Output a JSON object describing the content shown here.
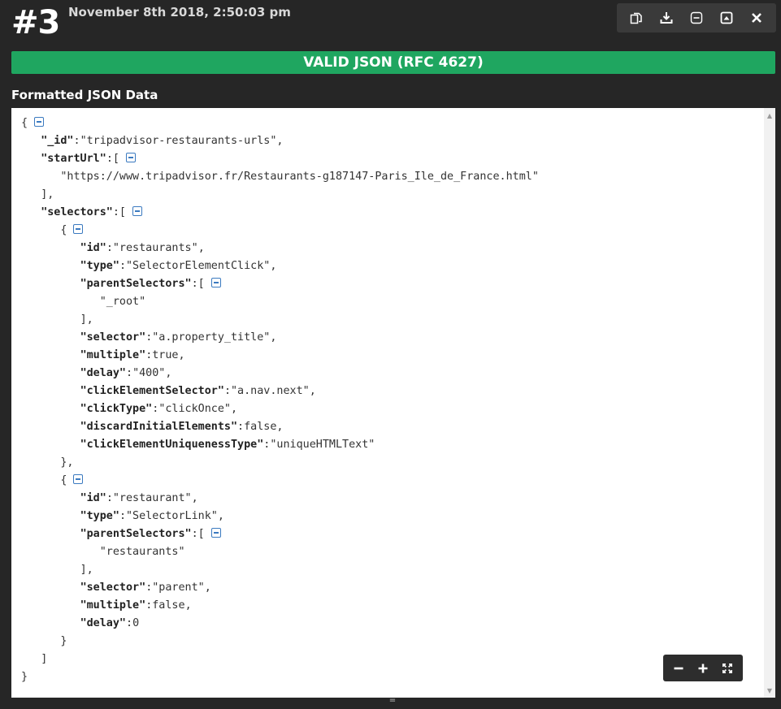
{
  "header": {
    "number": "#3",
    "timestamp": "November 8th 2018, 2:50:03 pm"
  },
  "toolbar": {
    "icons": [
      "copy-icon",
      "download-icon",
      "collapse-icon",
      "expand-up-icon",
      "close-icon"
    ]
  },
  "status": {
    "text": "VALID JSON (RFC 4627)",
    "color": "#1fa660"
  },
  "section_label": "Formatted JSON Data",
  "json": {
    "id_key": "\"_id\"",
    "id_val": "\"tripadvisor-restaurants-urls\"",
    "starturl_key": "\"startUrl\"",
    "starturl_val": "\"https://www.tripadvisor.fr/Restaurants-g187147-Paris_Ile_de_France.html\"",
    "selectors_key": "\"selectors\"",
    "s1": {
      "id_key": "\"id\"",
      "id_val": "\"restaurants\"",
      "type_key": "\"type\"",
      "type_val": "\"SelectorElementClick\"",
      "parent_key": "\"parentSelectors\"",
      "parent_val": "\"_root\"",
      "selector_key": "\"selector\"",
      "selector_val": "\"a.property_title\"",
      "multiple_key": "\"multiple\"",
      "multiple_val": "true",
      "delay_key": "\"delay\"",
      "delay_val": "\"400\"",
      "ces_key": "\"clickElementSelector\"",
      "ces_val": "\"a.nav.next\"",
      "ctype_key": "\"clickType\"",
      "ctype_val": "\"clickOnce\"",
      "die_key": "\"discardInitialElements\"",
      "die_val": "false",
      "ceut_key": "\"clickElementUniquenessType\"",
      "ceut_val": "\"uniqueHTMLText\""
    },
    "s2": {
      "id_key": "\"id\"",
      "id_val": "\"restaurant\"",
      "type_key": "\"type\"",
      "type_val": "\"SelectorLink\"",
      "parent_key": "\"parentSelectors\"",
      "parent_val": "\"restaurants\"",
      "selector_key": "\"selector\"",
      "selector_val": "\"parent\"",
      "multiple_key": "\"multiple\"",
      "multiple_val": "false",
      "delay_key": "\"delay\"",
      "delay_val": "0"
    }
  },
  "zoom": {
    "icons": [
      "zoom-out-icon",
      "zoom-in-icon",
      "fullscreen-icon"
    ]
  }
}
